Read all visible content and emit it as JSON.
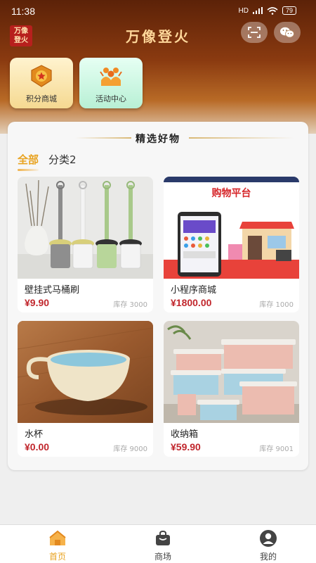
{
  "status": {
    "time": "11:38",
    "network": "HD",
    "battery": "79"
  },
  "header": {
    "logo_line1": "万像",
    "logo_line2": "登火",
    "title": "万像登火"
  },
  "quick_links": [
    {
      "label": "积分商城",
      "icon": "medal-icon"
    },
    {
      "label": "活动中心",
      "icon": "people-celebrate-icon"
    }
  ],
  "section": {
    "title": "精选好物"
  },
  "tabs": [
    {
      "label": "全部",
      "active": true
    },
    {
      "label": "分类2",
      "active": false
    }
  ],
  "products": [
    {
      "name": "壁挂式马桶刷",
      "price": "¥9.90",
      "stock": "库存 3000"
    },
    {
      "name": "小程序商城",
      "price": "¥1800.00",
      "stock": "库存 1000",
      "img_title": "购物平台"
    },
    {
      "name": "水杯",
      "price": "¥0.00",
      "stock": "库存 9000"
    },
    {
      "name": "收纳箱",
      "price": "¥59.90",
      "stock": "库存 9001"
    }
  ],
  "tabbar": [
    {
      "label": "首页",
      "icon": "home-icon",
      "active": true
    },
    {
      "label": "商场",
      "icon": "shopping-bag-icon",
      "active": false
    },
    {
      "label": "我的",
      "icon": "user-icon",
      "active": false
    }
  ],
  "colors": {
    "accent": "#e8a320",
    "price": "#c1272d",
    "header_dark": "#5c2208"
  }
}
